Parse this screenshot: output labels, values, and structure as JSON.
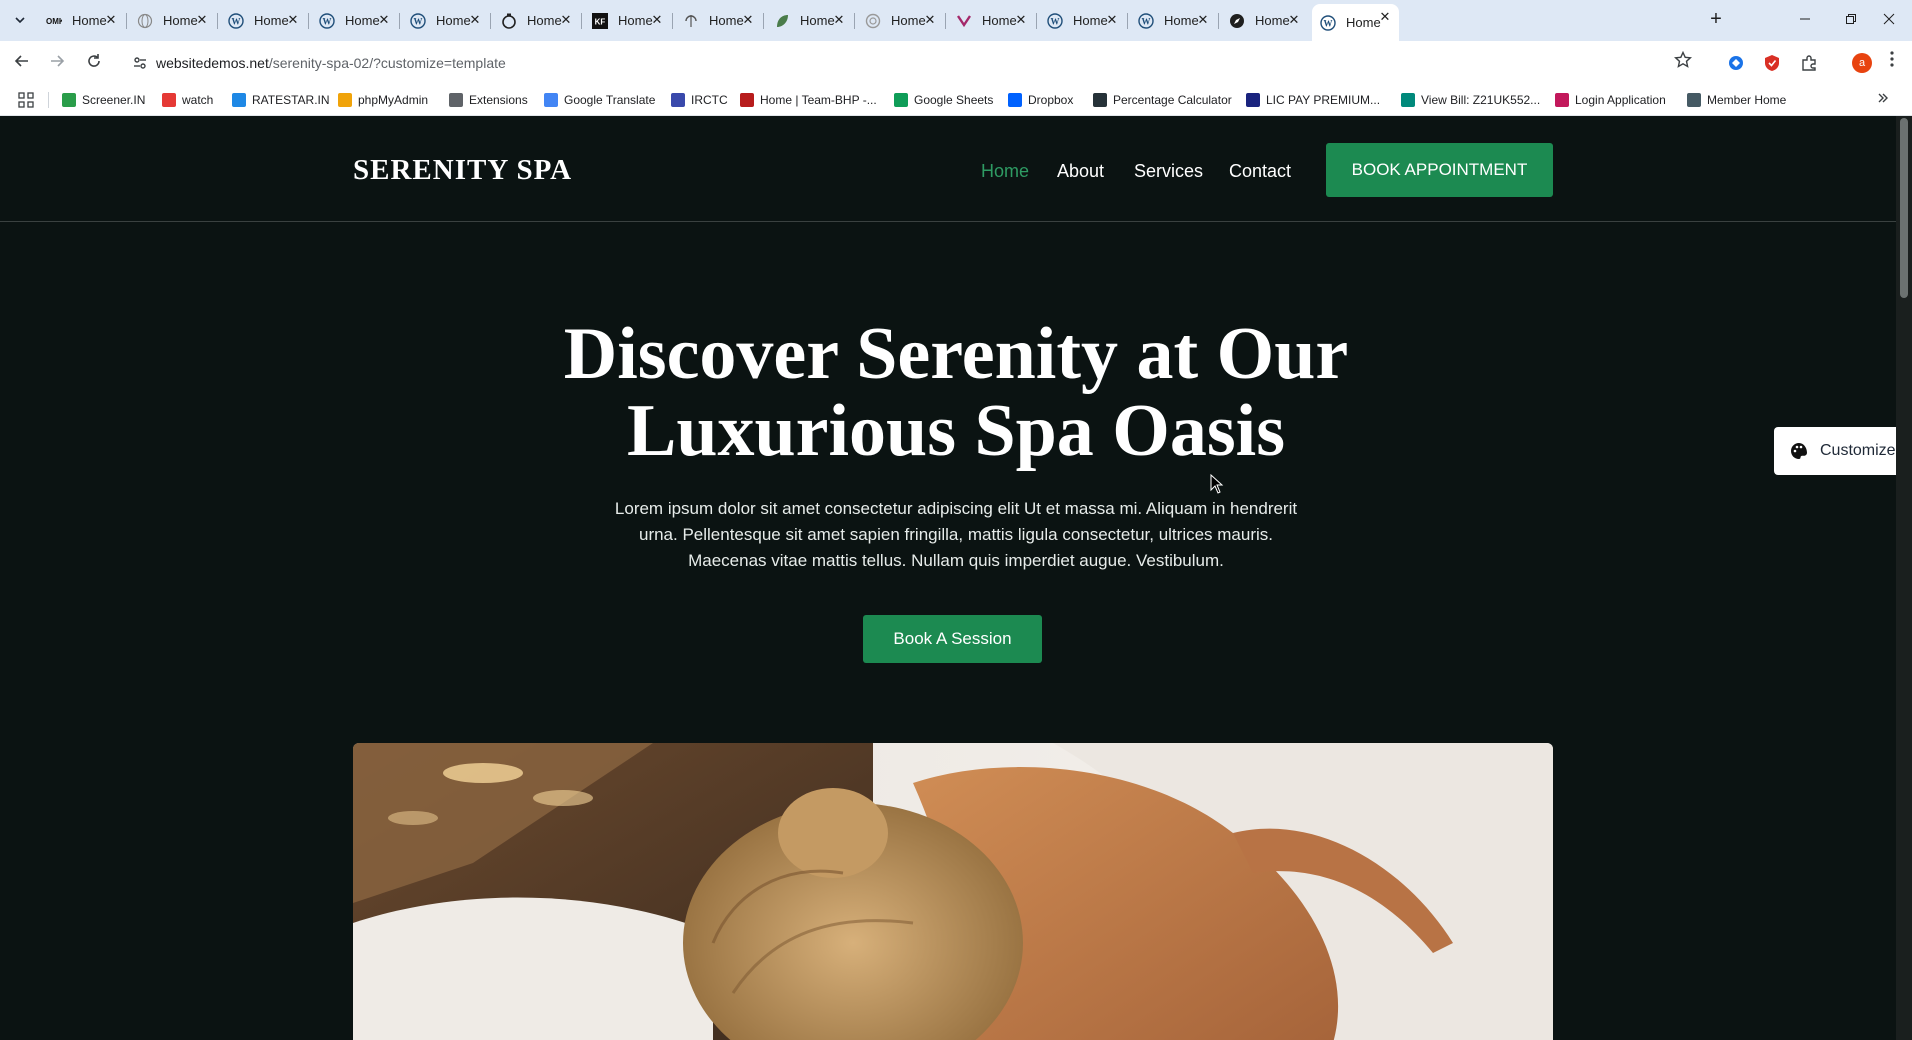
{
  "browser": {
    "tabs": [
      {
        "title": "Home",
        "icon": "omk-favicon"
      },
      {
        "title": "Home",
        "icon": "globe-favicon"
      },
      {
        "title": "Home",
        "icon": "wordpress-favicon"
      },
      {
        "title": "Home",
        "icon": "wordpress-favicon"
      },
      {
        "title": "Home",
        "icon": "wordpress-favicon"
      },
      {
        "title": "Home",
        "icon": "timer-favicon"
      },
      {
        "title": "Home",
        "icon": "kf-favicon"
      },
      {
        "title": "Home",
        "icon": "crosshair-favicon"
      },
      {
        "title": "Home",
        "icon": "leaf-favicon"
      },
      {
        "title": "Home",
        "icon": "shell-favicon"
      },
      {
        "title": "Home",
        "icon": "yoast-favicon"
      },
      {
        "title": "Home",
        "icon": "wordpress-favicon"
      },
      {
        "title": "Home",
        "icon": "wordpress-favicon"
      },
      {
        "title": "Home",
        "icon": "compass-favicon"
      },
      {
        "title": "Home",
        "icon": "wordpress-favicon",
        "active": true
      }
    ],
    "url_host": "websitedemos.net",
    "url_path": "/serenity-spa-02/?customize=template",
    "profile_initial": "a",
    "bookmarks": [
      {
        "label": "Screener.IN",
        "color": "#2a9d4a"
      },
      {
        "label": "watch",
        "color": "#e53935"
      },
      {
        "label": "RATESTAR.IN",
        "color": "#1e88e5"
      },
      {
        "label": "phpMyAdmin",
        "color": "#f0a30a"
      },
      {
        "label": "Extensions",
        "color": "#5f6368"
      },
      {
        "label": "Google Translate",
        "color": "#4285f4"
      },
      {
        "label": "IRCTC",
        "color": "#3949ab"
      },
      {
        "label": "Home | Team-BHP -...",
        "color": "#b71c1c"
      },
      {
        "label": "Google Sheets",
        "color": "#0f9d58"
      },
      {
        "label": "Dropbox",
        "color": "#0061fe"
      },
      {
        "label": "Percentage Calculator",
        "color": "#263238"
      },
      {
        "label": "LIC PAY PREMIUM...",
        "color": "#1a237e"
      },
      {
        "label": "View Bill: Z21UK552...",
        "color": "#00897b"
      },
      {
        "label": "Login Application",
        "color": "#c2185b"
      },
      {
        "label": "Member Home",
        "color": "#455a64"
      }
    ]
  },
  "site": {
    "logo": "SERENITY SPA",
    "nav": [
      {
        "label": "Home",
        "active": true
      },
      {
        "label": "About"
      },
      {
        "label": "Services"
      },
      {
        "label": "Contact"
      }
    ],
    "book_appointment": "BOOK APPOINTMENT",
    "hero_title_line1": "Discover Serenity at Our",
    "hero_title_line2": "Luxurious Spa Oasis",
    "hero_desc_line1": "Lorem ipsum dolor sit amet consectetur adipiscing elit Ut et massa mi. Aliquam in hendrerit",
    "hero_desc_line2": "urna. Pellentesque sit amet sapien fringilla, mattis ligula consectetur, ultrices mauris.",
    "hero_desc_line3": "Maecenas vitae mattis tellus. Nullam quis imperdiet augue. Vestibulum.",
    "session_button": "Book A Session",
    "customize": "Customize",
    "colors": {
      "page_bg": "#0b1312",
      "accent": "#1c8a51",
      "active_nav": "#2e9b63"
    }
  }
}
